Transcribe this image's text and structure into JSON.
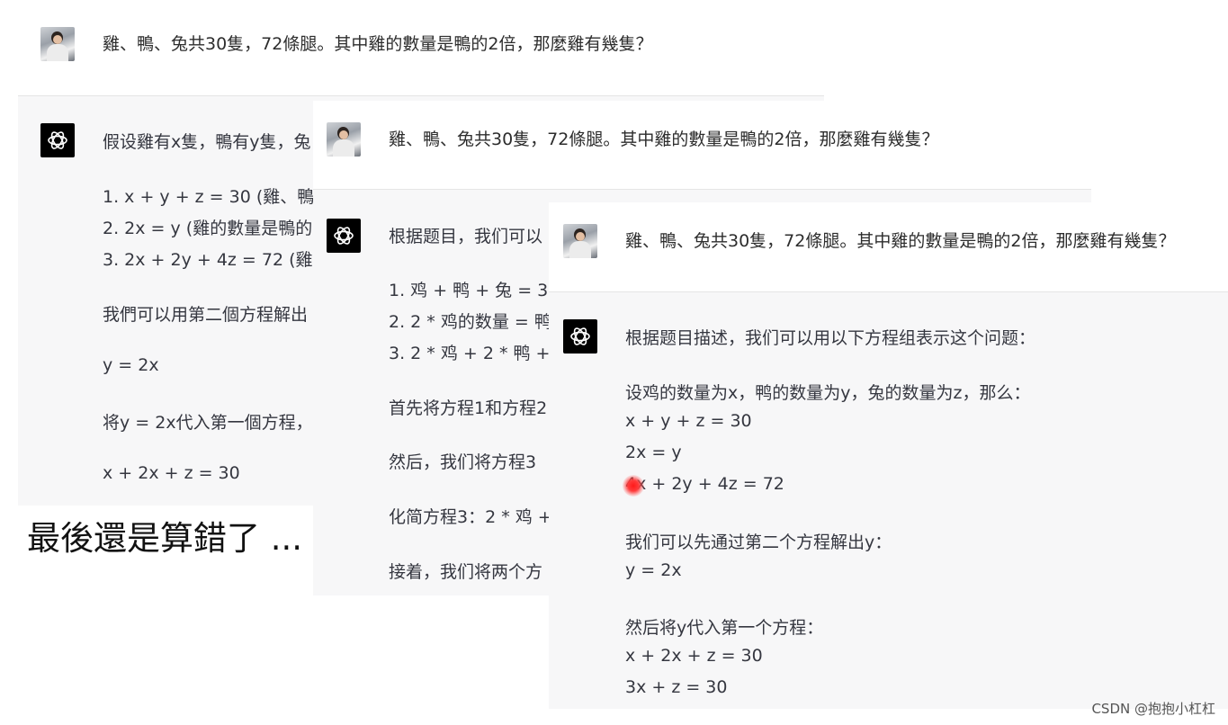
{
  "question": "雞、鴨、兔共30隻，72條腿。其中雞的數量是鴨的2倍，那麼雞有幾隻？",
  "panel1": {
    "answer_lines": [
      "假设雞有x隻，鴨有y隻，兔",
      "1.  x + y + z = 30 (雞、鴨",
      "2.  2x = y (雞的數量是鴨的",
      "3.  2x + 2y + 4z = 72 (雞和",
      "我們可以用第二個方程解出",
      "y = 2x",
      "将y = 2x代入第一個方程，",
      "x + 2x + z = 30"
    ]
  },
  "panel2": {
    "answer_lines": [
      "根据题目，我们可以",
      "1.  鸡 + 鸭 + 兔 = 30",
      "2.  2 * 鸡的数量 = 鸭",
      "3.  2 * 鸡 + 2 * 鸭 +",
      "首先将方程1和方程2",
      "然后，我们将方程3",
      "化简方程3：2 * 鸡 +",
      "接着，我们将两个方"
    ]
  },
  "panel3": {
    "answer_lines": [
      "根据题目描述，我们可以用以下方程组表示这个问题：",
      "设鸡的数量为x，鸭的数量为y，兔的数量为z，那么：",
      "x + y + z = 30",
      "2x = y",
      "4x + 2y + 4z = 72",
      "我们可以先通过第二个方程解出y：",
      "y = 2x",
      "然后将y代入第一个方程：",
      "x + 2x + z = 30",
      "3x + z = 30"
    ]
  },
  "caption": "最後還是算錯了 ...",
  "watermark": "CSDN @抱抱小杠杠",
  "icons": {
    "user_avatar": "user-photo-avatar",
    "assistant": "chatgpt-logo-icon"
  },
  "colors": {
    "bot_background": "#f7f7f8",
    "icon_background": "#000000",
    "cursor_highlight": "#ff2a2a"
  }
}
